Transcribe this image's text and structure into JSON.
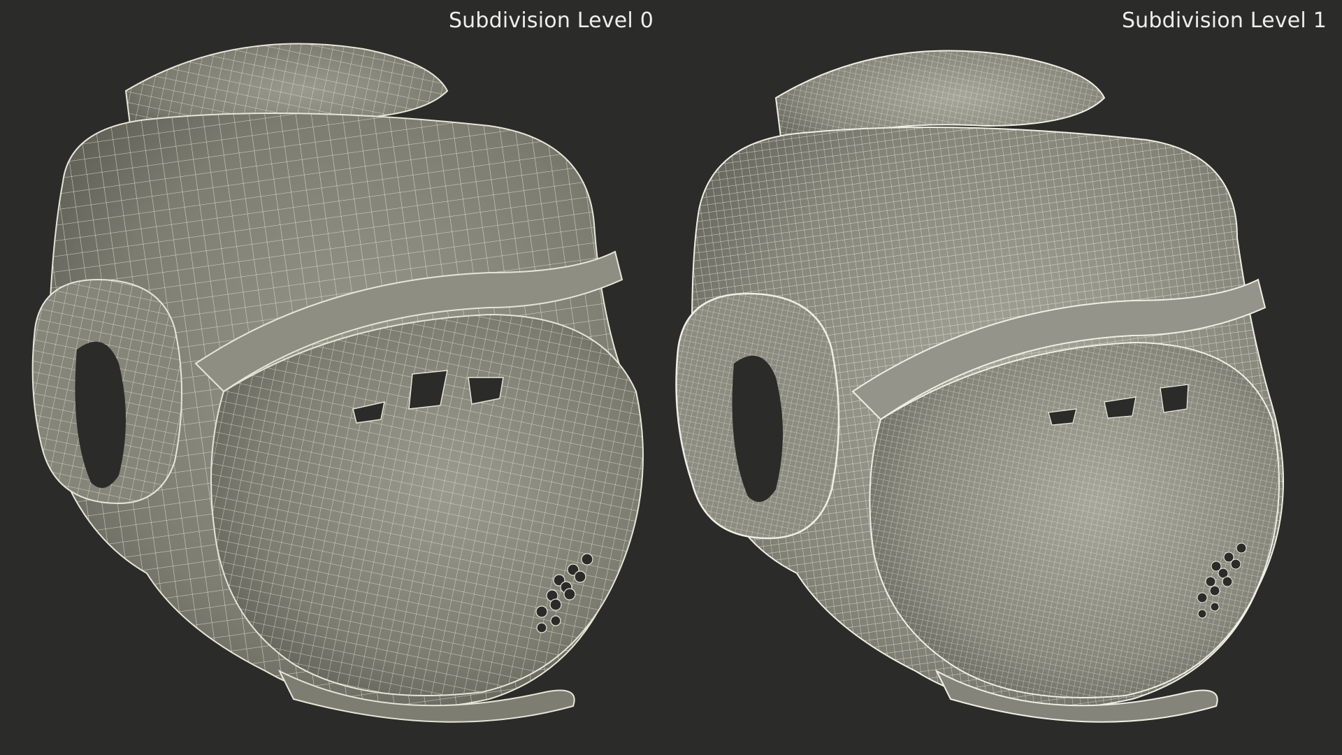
{
  "panels": [
    {
      "label": "Subdivision Level 0",
      "subject": "headgear wireframe render",
      "wire_color": "#e6e6d8",
      "fill_color": "#8f8f84"
    },
    {
      "label": "Subdivision Level 1",
      "subject": "headgear wireframe render",
      "wire_color": "#efefe4",
      "fill_color": "#9c9c90"
    }
  ],
  "background_color": "#2b2b2a"
}
